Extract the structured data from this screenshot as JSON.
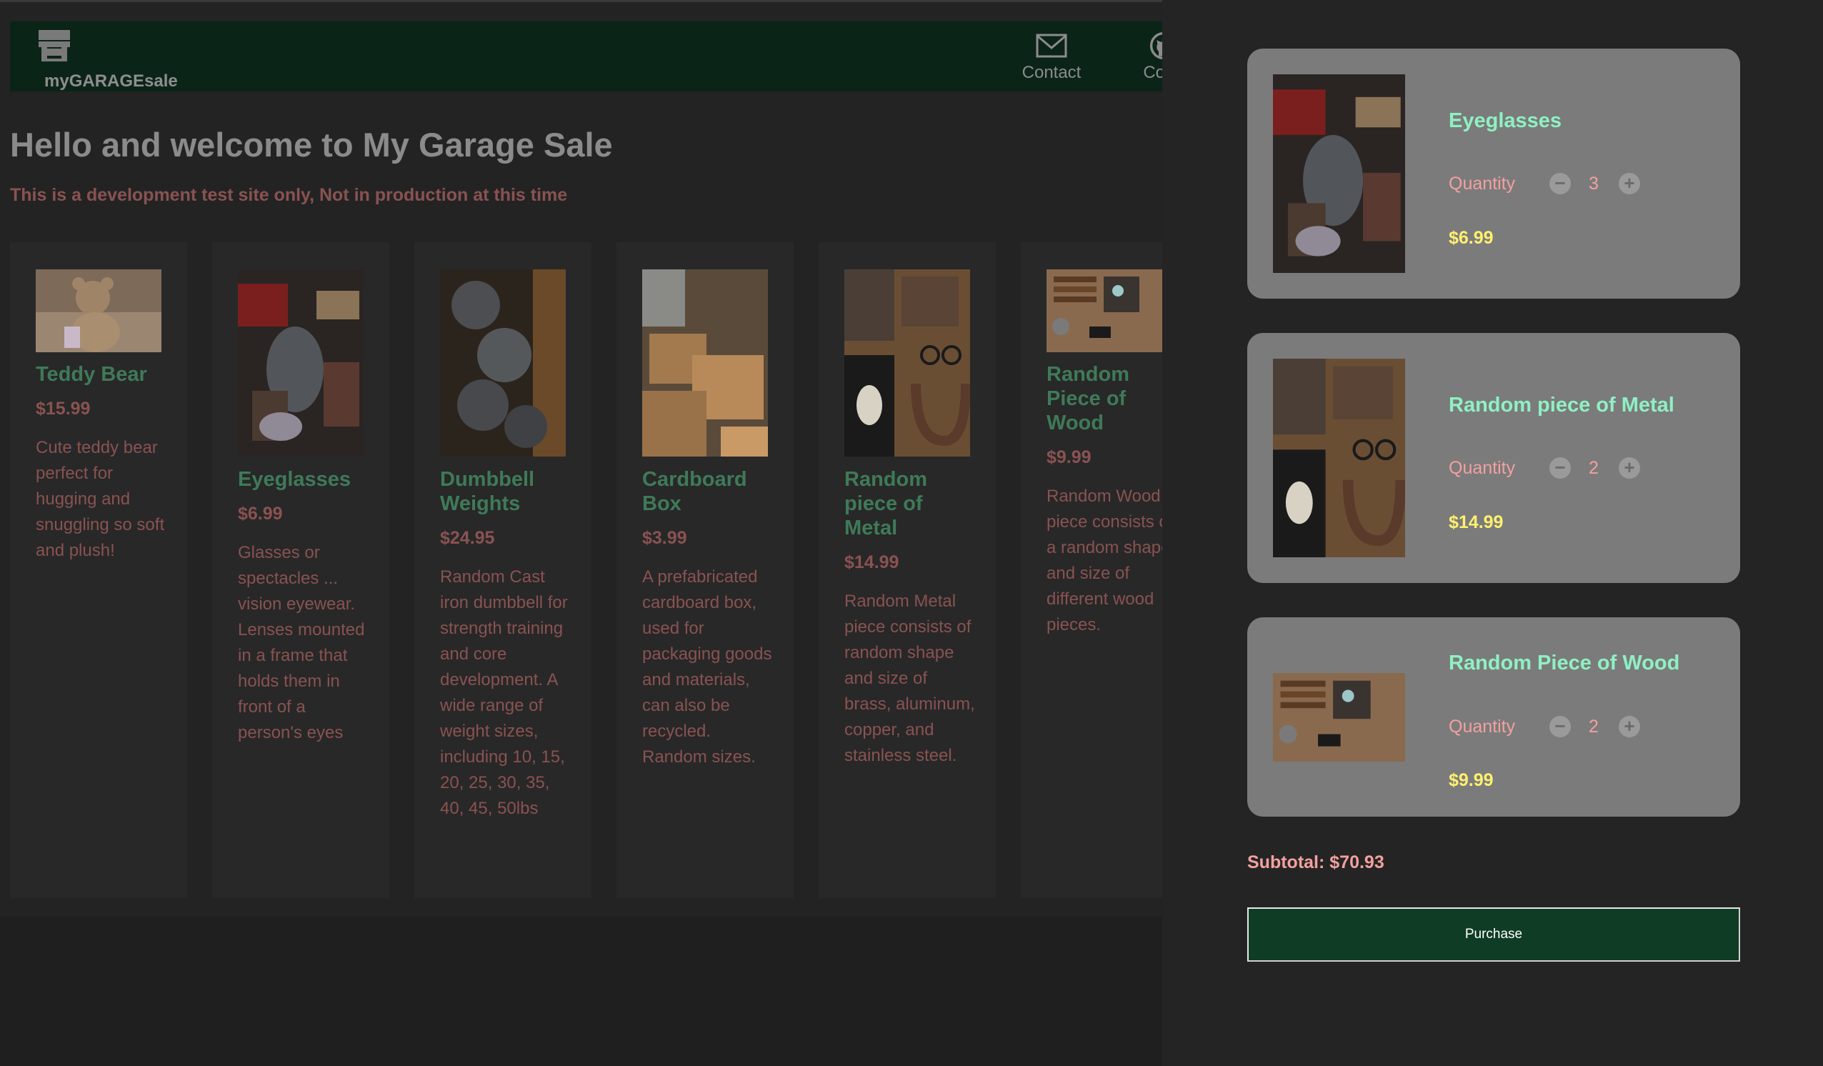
{
  "brand": {
    "name": "myGARAGEsale",
    "icon": "store-icon"
  },
  "nav": {
    "contact_label": "Contact",
    "contact_icon": "mail-icon",
    "code_label": "Code",
    "code_icon": "github-icon"
  },
  "hero": {
    "title": "Hello and welcome to My Garage Sale",
    "subtitle": "This is a development test site only, Not in production at this time"
  },
  "products": [
    {
      "title": "Teddy Bear",
      "price": "$15.99",
      "description": "Cute teddy bear perfect for hugging and snuggling so soft and plush!"
    },
    {
      "title": "Eyeglasses",
      "price": "$6.99",
      "description": "Glasses or spectacles ... vision eyewear. Lenses mounted in a frame that holds them in front of a person's eyes"
    },
    {
      "title": "Dumbbell Weights",
      "price": "$24.95",
      "description": "Random Cast iron dumbbell for strength training and core development. A wide range of weight sizes, including 10, 15, 20, 25, 30, 35, 40, 45, 50lbs"
    },
    {
      "title": "Cardboard Box",
      "price": "$3.99",
      "description": "A prefabricated cardboard box, used for packaging goods and materials, can also be recycled. Random sizes."
    },
    {
      "title": "Random piece of Metal",
      "price": "$14.99",
      "description": "Random Metal piece consists of random shape and size of brass, aluminum, copper, and stainless steel."
    },
    {
      "title": "Random Piece of Wood",
      "price": "$9.99",
      "description": "Random Wood piece consists of a random shape and size of different wood pieces."
    }
  ],
  "cart": {
    "quantity_label": "Quantity",
    "items": [
      {
        "name": "Eyeglasses",
        "quantity": "3",
        "price": "$6.99"
      },
      {
        "name": "Random piece of Metal",
        "quantity": "2",
        "price": "$14.99"
      },
      {
        "name": "Random Piece of Wood",
        "quantity": "2",
        "price": "$9.99"
      }
    ],
    "subtotal": "Subtotal: $70.93",
    "purchase_label": "Purchase"
  },
  "colors": {
    "navbar": "#0b2418",
    "product_title": "#3f7a59",
    "cart_item_name": "#8ff0c3",
    "cart_price": "#fff06e",
    "purchase_button": "#0f3c25"
  }
}
